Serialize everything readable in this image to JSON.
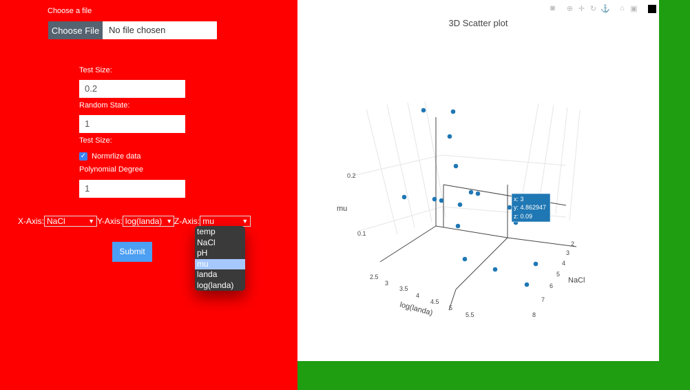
{
  "form": {
    "choose_file_label": "Choose a file",
    "choose_file_button": "Choose File",
    "file_status": "No file chosen",
    "test_size_label": "Test Size:",
    "test_size_value": "0.2",
    "random_state_label": "Random State:",
    "random_state_value": "1",
    "test_size_label_2": "Test Size:",
    "normalize_label": "Normrlize data",
    "normalize_checked": true,
    "poly_degree_label": "Polynomial Degree",
    "poly_degree_value": "1",
    "x_axis_label": "X-Axis:",
    "x_axis_value": "NaCl",
    "y_axis_label": "Y-Axis:",
    "y_axis_value": "log(landa)",
    "z_axis_label": "Z-Axis:",
    "z_axis_value": "mu",
    "z_axis_options": [
      "temp",
      "NaCl",
      "pH",
      "mu",
      "landa",
      "log(landa)"
    ],
    "submit_label": "Submit"
  },
  "colors": {
    "form_bg": "#ff0000",
    "page_bg": "#1f9e12",
    "marker": "#1f77b4",
    "submit": "#4c9ff2"
  },
  "plot": {
    "title": "3D Scatter plot",
    "modebar_icons": [
      "camera-icon",
      "zoom-icon",
      "pan-icon",
      "orbit-icon",
      "turntable-icon",
      "home-icon",
      "camera-view-icon",
      "plotly-logo-icon"
    ],
    "hover": {
      "x": "x: 3",
      "y": "y: 4.862947",
      "z": "z: 0.09"
    }
  },
  "chart_data": {
    "type": "scatter",
    "title": "3D Scatter plot",
    "xlabel": "NaCl",
    "ylabel": "log(landa)",
    "zlabel": "mu",
    "x_ticks": [
      "2",
      "3",
      "4",
      "5",
      "6",
      "7",
      "8"
    ],
    "y_ticks": [
      "2.5",
      "3",
      "3.5",
      "4",
      "4.5",
      "5",
      "5.5"
    ],
    "z_ticks": [
      "0.1",
      "0.2"
    ],
    "points": [
      {
        "x": 3,
        "y": 4.862947,
        "z": 0.09
      }
    ]
  }
}
